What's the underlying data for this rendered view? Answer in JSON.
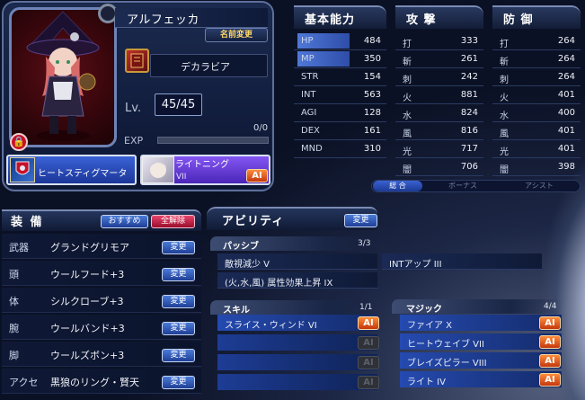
{
  "character": {
    "name": "アルフェッカ",
    "rename_label": "名前変更",
    "weapon_name": "デカラビア",
    "level_label": "Lv.",
    "level": "45/45",
    "exp_label": "EXP",
    "exp_value": "0/0",
    "exp_progress": 0.0,
    "skill_slot1": "ヒートスティグマータ",
    "skill_slot2_name": "ライトニング",
    "skill_slot2_level": "VII",
    "ai_label": "AI"
  },
  "basic_stats": {
    "title": "基本能力",
    "rows": [
      {
        "label": "HP",
        "value": "484"
      },
      {
        "label": "MP",
        "value": "350"
      },
      {
        "label": "STR",
        "value": "154"
      },
      {
        "label": "INT",
        "value": "563"
      },
      {
        "label": "AGI",
        "value": "128"
      },
      {
        "label": "DEX",
        "value": "161"
      },
      {
        "label": "MND",
        "value": "310"
      }
    ]
  },
  "attack_stats": {
    "title": "攻 撃",
    "rows": [
      {
        "label": "打",
        "value": "333"
      },
      {
        "label": "斬",
        "value": "261"
      },
      {
        "label": "刺",
        "value": "242"
      },
      {
        "label": "火",
        "value": "881"
      },
      {
        "label": "水",
        "value": "824"
      },
      {
        "label": "風",
        "value": "816"
      },
      {
        "label": "光",
        "value": "717"
      },
      {
        "label": "闇",
        "value": "706"
      }
    ]
  },
  "defense_stats": {
    "title": "防 御",
    "rows": [
      {
        "label": "打",
        "value": "264"
      },
      {
        "label": "斬",
        "value": "264"
      },
      {
        "label": "刺",
        "value": "264"
      },
      {
        "label": "火",
        "value": "401"
      },
      {
        "label": "水",
        "value": "400"
      },
      {
        "label": "風",
        "value": "401"
      },
      {
        "label": "光",
        "value": "401"
      },
      {
        "label": "闇",
        "value": "398"
      }
    ]
  },
  "stat_tabs": [
    "総 合",
    "ボーナス",
    "アシスト"
  ],
  "equipment": {
    "title": "装 備",
    "recommend_label": "おすすめ",
    "clear_label": "全解除",
    "change_label": "変更",
    "rows": [
      {
        "slot": "武器",
        "item": "グランドグリモア"
      },
      {
        "slot": "頭",
        "item": "ウールフード+3"
      },
      {
        "slot": "体",
        "item": "シルクローブ+3"
      },
      {
        "slot": "腕",
        "item": "ウールバンド+3"
      },
      {
        "slot": "脚",
        "item": "ウールズボン+3"
      },
      {
        "slot": "アクセ",
        "item": "黒狼のリング・賢天"
      }
    ]
  },
  "ability": {
    "title": "アビリティ",
    "change_label": "変更",
    "passive": {
      "title": "パッシブ",
      "count": "3/3",
      "items": [
        "敵視減少 V",
        "(火,水,風) 属性効果上昇 IX",
        "INTアップ III"
      ]
    },
    "skill": {
      "title": "スキル",
      "count": "1/1",
      "items": [
        "スライス・ウィンド VI",
        "",
        "",
        ""
      ]
    },
    "magic": {
      "title": "マジック",
      "count": "4/4",
      "items": [
        "ファイア X",
        "ヒートウェイブ VII",
        "ブレイズピラー VIII",
        "ライト IV"
      ]
    }
  },
  "colors": {
    "accent": "#3a62d6",
    "ai_badge": "#e8551c",
    "danger": "#c8102a"
  },
  "icons": [
    "lock-icon",
    "grimoire-icon",
    "skill-emblem-icon",
    "avatar-thumbnail"
  ]
}
